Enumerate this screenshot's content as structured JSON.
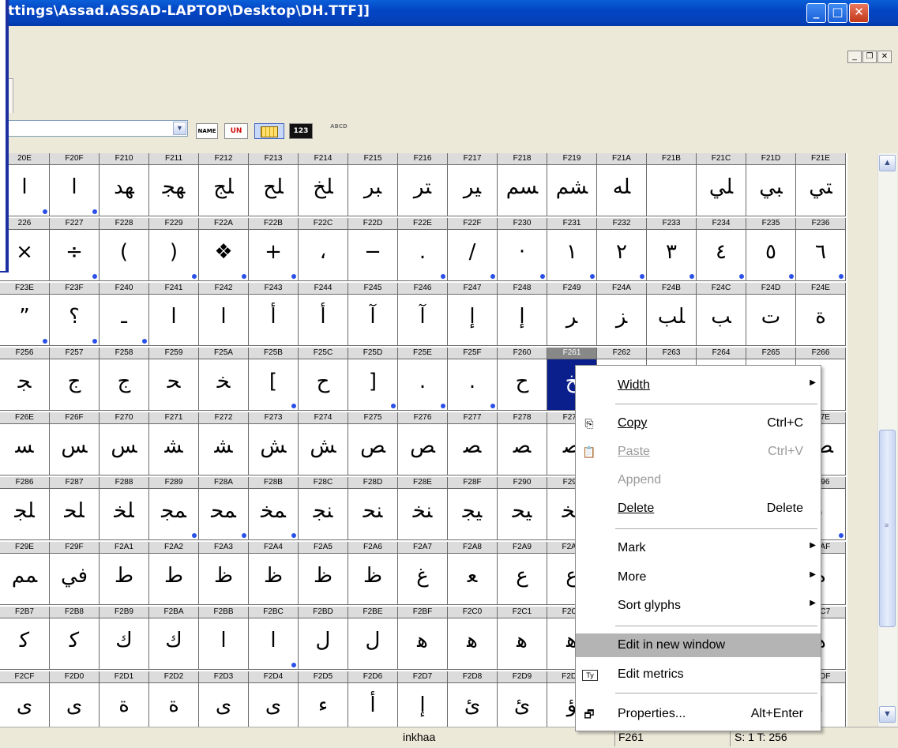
{
  "window": {
    "title": "ttings\\Assad.ASSAD-LAPTOP\\Desktop\\DH.TTF]]"
  },
  "grid": {
    "rows": [
      {
        "labels": [
          "20E",
          "F20F",
          "F210",
          "F211",
          "F212",
          "F213",
          "F214",
          "F215",
          "F216",
          "F217",
          "F218",
          "F219",
          "F21A",
          "F21B",
          "F21C",
          "F21D",
          "F21E"
        ],
        "glyphs": [
          "ا",
          "ا",
          "ﻬﺪ",
          "ﻬﺠ",
          "ﻠﺞ",
          "ﻠﺢ",
          "ﻠﺦ",
          "ﺒﺮ",
          "ﺘﺮ",
          "ﻴﺮ",
          "ﺴﻢ",
          "ﺸﻢ",
          "ﻠﻪ",
          "",
          "ﻠﻲ",
          "ﺒﻲ",
          "ﺘﻲ"
        ],
        "dots": [
          true,
          true,
          false,
          false,
          false,
          false,
          false,
          false,
          false,
          false,
          false,
          false,
          false,
          false,
          false,
          false,
          false
        ]
      },
      {
        "labels": [
          "226",
          "F227",
          "F228",
          "F229",
          "F22A",
          "F22B",
          "F22C",
          "F22D",
          "F22E",
          "F22F",
          "F230",
          "F231",
          "F232",
          "F233",
          "F234",
          "F235",
          "F236"
        ],
        "glyphs": [
          "×",
          "÷",
          "(",
          ")",
          "❖",
          "+",
          "،",
          "−",
          ".",
          "/",
          "·",
          "١",
          "٢",
          "٣",
          "٤",
          "٥",
          "٦"
        ],
        "dots": [
          false,
          true,
          false,
          true,
          true,
          true,
          false,
          false,
          true,
          true,
          true,
          true,
          true,
          true,
          true,
          true,
          true
        ]
      },
      {
        "labels": [
          "F23E",
          "F23F",
          "F240",
          "F241",
          "F242",
          "F243",
          "F244",
          "F245",
          "F246",
          "F247",
          "F248",
          "F249",
          "F24A",
          "F24B",
          "F24C",
          "F24D",
          "F24E"
        ],
        "glyphs": [
          "”",
          "؟",
          "ـ",
          "ا",
          "ا",
          "أ",
          "أ",
          "آ",
          "آ",
          "إ",
          "إ",
          "ﺮ",
          "ﺰ",
          "ﻠﺐ",
          "ﺐ",
          "ﺕ",
          "ﺓ"
        ],
        "dots": [
          true,
          true,
          true,
          false,
          false,
          false,
          false,
          false,
          false,
          false,
          false,
          false,
          false,
          false,
          false,
          false,
          false
        ]
      },
      {
        "labels": [
          "F256",
          "F257",
          "F258",
          "F259",
          "F25A",
          "F25B",
          "F25C",
          "F25D",
          "F25E",
          "F25F",
          "F260",
          "F261",
          "F262",
          "F263",
          "F264",
          "F265",
          "F266"
        ],
        "glyphs": [
          "ﺠ",
          "ﺝ",
          "ﺝ",
          "ﺤ",
          "ﺨ",
          "[",
          "ﺡ",
          "]",
          ".",
          ".",
          "ﺡ",
          "ﺦ",
          "",
          "",
          "",
          "",
          ""
        ],
        "dots": [
          false,
          false,
          false,
          false,
          false,
          true,
          false,
          true,
          true,
          true,
          false,
          false,
          false,
          false,
          false,
          false,
          false
        ]
      },
      {
        "labels": [
          "F26E",
          "F26F",
          "F270",
          "F271",
          "F272",
          "F273",
          "F274",
          "F275",
          "F276",
          "F277",
          "F278",
          "F279",
          "",
          "",
          "",
          "",
          "F27E"
        ],
        "glyphs": [
          "ﺴ",
          "ﺲ",
          "ﺲ",
          "ﺸ",
          "ﺸ",
          "ﺶ",
          "ﺶ",
          "ﺺ",
          "ﺺ",
          "ﺼ",
          "ﺼ",
          "ﺼ",
          "",
          "",
          "",
          "",
          "ﺺ"
        ],
        "dots": [
          false,
          false,
          false,
          false,
          false,
          false,
          false,
          false,
          false,
          false,
          false,
          false,
          false,
          false,
          false,
          false,
          false
        ]
      },
      {
        "labels": [
          "F286",
          "F287",
          "F288",
          "F289",
          "F28A",
          "F28B",
          "F28C",
          "F28D",
          "F28E",
          "F28F",
          "F290",
          "F291",
          "",
          "",
          "",
          "",
          "F296"
        ],
        "glyphs": [
          "ﻠﺠ",
          "ﻠﺤ",
          "ﻠﺨ",
          "ﻤﺠ",
          "ﻤﺤ",
          "ﻤﺨ",
          "ﻨﺠ",
          "ﻨﺤ",
          "ﻨﺨ",
          "ﻴﺠ",
          "ﻴﺤ",
          "ﻴﺨ",
          "",
          "",
          "",
          "",
          "ﺑ"
        ],
        "dots": [
          false,
          false,
          false,
          true,
          true,
          true,
          false,
          false,
          false,
          false,
          false,
          false,
          false,
          false,
          false,
          false,
          true
        ]
      },
      {
        "labels": [
          "F29E",
          "F29F",
          "F2A1",
          "F2A2",
          "F2A3",
          "F2A4",
          "F2A5",
          "F2A6",
          "F2A7",
          "F2A8",
          "F2A9",
          "F2AA",
          "",
          "",
          "",
          "",
          "F2AF"
        ],
        "glyphs": [
          "ﻤﻢ",
          "ﻓﻲ",
          "ﻁ",
          "ﻁ",
          "ﻅ",
          "ﻅ",
          "ﻅ",
          "ﻅ",
          "ﻍ",
          "ﻌ",
          "ﻉ",
          "ﻉ",
          "",
          "",
          "",
          "",
          "ﻩ"
        ],
        "dots": [
          false,
          false,
          false,
          false,
          false,
          false,
          false,
          false,
          false,
          false,
          false,
          false,
          false,
          false,
          false,
          false,
          false
        ]
      },
      {
        "labels": [
          "F2B7",
          "F2B8",
          "F2B9",
          "F2BA",
          "F2BB",
          "F2BC",
          "F2BD",
          "F2BE",
          "F2BF",
          "F2C0",
          "F2C1",
          "F2C2",
          "",
          "",
          "",
          "",
          "F2C7"
        ],
        "glyphs": [
          "ﻛ",
          "ﻛ",
          "ﻙ",
          "ﻙ",
          "ا",
          "ا",
          "ﻝ",
          "ﻝ",
          "ﻫ",
          "ﻫ",
          "ﻫ",
          "ﻫ",
          "",
          "",
          "",
          "",
          "ﻫ"
        ],
        "dots": [
          false,
          false,
          false,
          false,
          false,
          true,
          false,
          false,
          false,
          false,
          false,
          false,
          false,
          false,
          false,
          false,
          false
        ]
      },
      {
        "labels": [
          "F2CF",
          "F2D0",
          "F2D1",
          "F2D2",
          "F2D3",
          "F2D4",
          "F2D5",
          "F2D6",
          "F2D7",
          "F2D8",
          "F2D9",
          "F2DA",
          "",
          "",
          "",
          "",
          "F2DF"
        ],
        "glyphs": [
          "ى",
          "ى",
          "ة",
          "ة",
          "ى",
          "ى",
          "ء",
          "أ",
          "إ",
          "ئ",
          "ئ",
          "ؤ",
          "",
          "",
          "",
          "",
          "ا"
        ],
        "dots": [
          false,
          false,
          false,
          false,
          false,
          false,
          false,
          false,
          false,
          false,
          false,
          false,
          false,
          false,
          false,
          false,
          false
        ]
      }
    ]
  },
  "context_menu": {
    "width": "Width",
    "copy": "Copy",
    "copy_key": "Ctrl+C",
    "paste": "Paste",
    "paste_key": "Ctrl+V",
    "append": "Append",
    "delete": "Delete",
    "delete_key": "Delete",
    "mark": "Mark",
    "more": "More",
    "sort_glyphs": "Sort glyphs",
    "edit_new_window": "Edit in new window",
    "edit_metrics": "Edit metrics",
    "properties": "Properties...",
    "properties_key": "Alt+Enter"
  },
  "status": {
    "glyph_name": "inkhaa",
    "code": "F261",
    "selection": "S: 1 T: 256"
  }
}
